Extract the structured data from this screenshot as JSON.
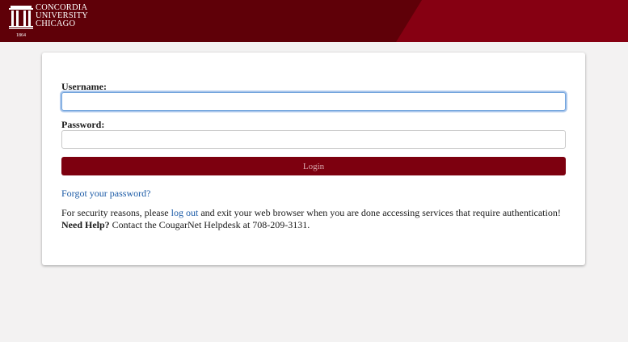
{
  "header": {
    "logo_lines": [
      "CONCORDIA",
      "UNIVERSITY",
      "CHICAGO"
    ],
    "logo_year": "1864"
  },
  "form": {
    "username_label": "Username:",
    "username_value": "",
    "password_label": "Password:",
    "password_value": "",
    "login_label": "Login",
    "forgot_link": "Forgot your password?"
  },
  "notice": {
    "line1_before": "For security reasons, please ",
    "line1_link": "log out",
    "line1_after": " and exit your web browser when you are done accessing services that require authentication!",
    "help_bold": "Need Help?",
    "help_text": " Contact the CougarNet Helpdesk at 708-209-3131."
  },
  "colors": {
    "header_dark": "#5f0008",
    "header_accent": "#860012",
    "button": "#7d000f",
    "link": "#1a5aa6"
  }
}
